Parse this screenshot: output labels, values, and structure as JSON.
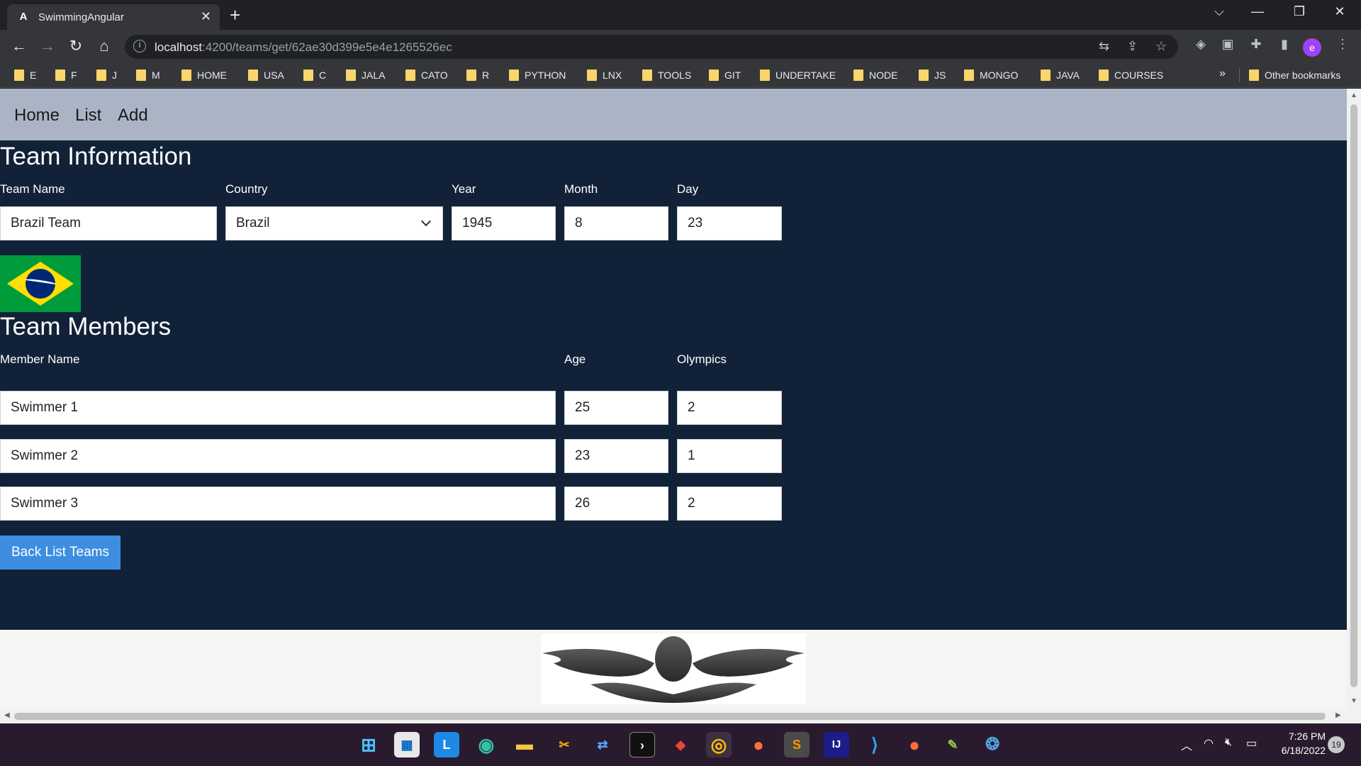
{
  "browser": {
    "tab_title": "SwimmingAngular",
    "tab_favicon": "A",
    "url_host": "localhost",
    "url_path": ":4200/teams/get/62ae30d399e5e4e1265526ec",
    "profile_initial": "e",
    "bookmarks": [
      "E",
      "F",
      "J",
      "M",
      "HOME",
      "USA",
      "C",
      "JALA",
      "CATO",
      "R",
      "PYTHON",
      "LNX",
      "TOOLS",
      "GIT",
      "UNDERTAKE",
      "NODE",
      "JS",
      "MONGO",
      "JAVA",
      "COURSES"
    ],
    "bookmarks_more": "»",
    "other_bookmarks": "Other bookmarks"
  },
  "nav": {
    "home": "Home",
    "list": "List",
    "add": "Add"
  },
  "team_info": {
    "title": "Team Information",
    "labels": {
      "team_name": "Team Name",
      "country": "Country",
      "year": "Year",
      "month": "Month",
      "day": "Day"
    },
    "values": {
      "team_name": "Brazil Team",
      "country": "Brazil",
      "year": "1945",
      "month": "8",
      "day": "23"
    }
  },
  "members": {
    "title": "Team Members",
    "labels": {
      "member_name": "Member Name",
      "age": "Age",
      "olympics": "Olympics"
    },
    "rows": [
      {
        "name": "Swimmer 1",
        "age": "25",
        "olympics": "2"
      },
      {
        "name": "Swimmer 2",
        "age": "23",
        "olympics": "1"
      },
      {
        "name": "Swimmer 3",
        "age": "26",
        "olympics": "2"
      }
    ]
  },
  "back_button": "Back List Teams",
  "taskbar": {
    "time": "7:26 PM",
    "date": "6/18/2022",
    "notifications": "19"
  },
  "colors": {
    "page_bg": "#112238",
    "nav_bg": "#aab4c4",
    "button_bg": "#3d8ee0"
  }
}
